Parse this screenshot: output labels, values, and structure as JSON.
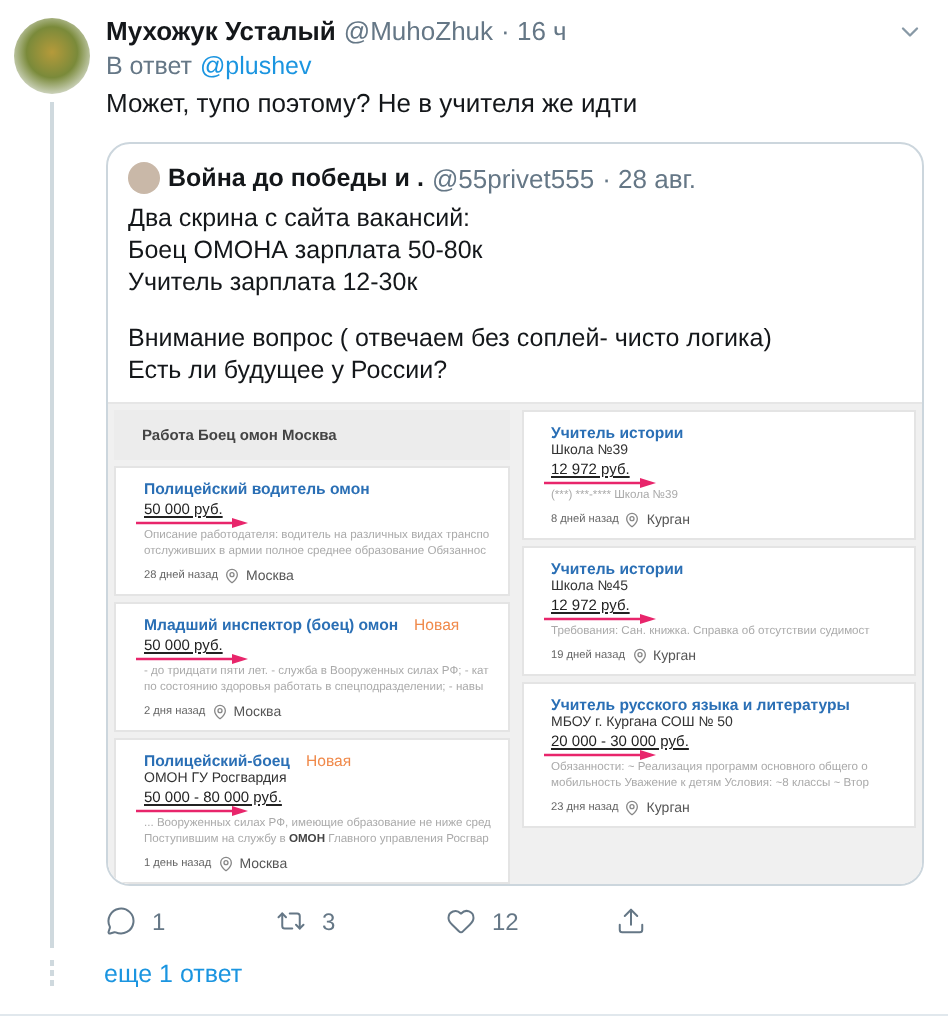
{
  "tweet": {
    "author": "Мухожук Усталый",
    "handle": "@MuhoZhuk",
    "time": "· 16 ч",
    "reply_label": "В ответ",
    "reply_to": "@plushev",
    "text": "Может, тупо поэтому? Не в учителя же идти"
  },
  "quote": {
    "author": "Война до победы и .",
    "handle": "@55privet555",
    "time": "· 28 авг.",
    "paragraphs": [
      [
        "Два скрина с сайта вакансий:",
        "Боец ОМОНА зарплата 50-80к",
        "Учитель зарплата 12-30к"
      ],
      [
        "Внимание вопрос ( отвечаем без соплей- чисто логика)",
        "Есть ли будущее у России?"
      ]
    ],
    "image": {
      "left": {
        "header": "Работа Боец омон Москва",
        "cards": [
          {
            "title": "Полицейский водитель омон",
            "salary": "50 000 руб.",
            "description": [
              "Описание работодателя: водитель на различных видах транспо",
              "отслуживших в армии полное среднее образование Обязаннос"
            ],
            "age": "28 дней назад",
            "location": "Москва"
          },
          {
            "title": "Младший инспектор (боец) омон",
            "badge": "Новая",
            "salary": "50 000 руб.",
            "description": [
              "- до тридцати пяти лет. - служба в Вооруженных силах РФ; - кат",
              "по состоянию здоровья работать в спецподразделении; - навы"
            ],
            "age": "2 дня назад",
            "location": "Москва"
          },
          {
            "title": "Полицейский-боец",
            "badge": "Новая",
            "company": "ОМОН ГУ Росгвардия",
            "salary": "50 000 - 80 000 руб.",
            "description": [
              [
                {
                  "text": "... Вооруженных силах РФ, имеющие образование не ниже сред",
                  "bold": false
                }
              ],
              [
                {
                  "text": "Поступившим на службу в ",
                  "bold": false
                },
                {
                  "text": "ОМОН",
                  "bold": true
                },
                {
                  "text": " Главного управления Росгвар",
                  "bold": false
                }
              ]
            ],
            "age": "1 день назад",
            "location": "Москва"
          }
        ]
      },
      "right": {
        "cards": [
          {
            "title": "Учитель истории",
            "company": "Школа №39",
            "salary": "12 972 руб.",
            "description": [
              [
                {
                  "text": "(***) ***-**** Школа №39",
                  "bold": false
                }
              ]
            ],
            "age": "8 дней назад",
            "location": "Курган"
          },
          {
            "title": "Учитель истории",
            "company": "Школа №45",
            "salary": "12 972 руб.",
            "description": [
              "Требования: Сан. книжка. Справка об отсутствии судимост"
            ],
            "age": "19 дней назад",
            "location": "Курган"
          },
          {
            "title": "Учитель русского языка и литературы",
            "company": "МБОУ г. Кургана СОШ № 50",
            "salary": "20 000 - 30 000 руб.",
            "description": [
              "Обязанности: ~ Реализация программ основного общего о",
              "мобильность Уважение к детям Условия: ~8 классы ~ Втор"
            ],
            "age": "23 дня назад",
            "location": "Курган"
          }
        ]
      }
    }
  },
  "actions": [
    {
      "kind": "reply",
      "count": "1"
    },
    {
      "kind": "retweet",
      "count": "3"
    },
    {
      "kind": "like",
      "count": "12"
    },
    {
      "kind": "share"
    }
  ],
  "more_replies": "еще 1 ответ"
}
